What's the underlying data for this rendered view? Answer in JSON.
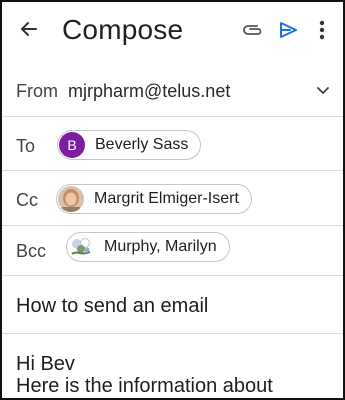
{
  "app_bar": {
    "title": "Compose",
    "back_icon": "arrow-left-icon",
    "attach_icon": "paperclip-icon",
    "send_icon": "send-icon",
    "more_icon": "more-vertical-icon"
  },
  "from": {
    "label": "From",
    "value": "mjrpharm@telus.net",
    "chevron_icon": "chevron-down-icon"
  },
  "to": {
    "label": "To",
    "recipients": [
      {
        "name": "Beverly Sass",
        "avatar_letter": "B",
        "avatar_color": "#7b1fa2"
      }
    ]
  },
  "cc": {
    "label": "Cc",
    "recipients": [
      {
        "name": "Margrit Elmiger-Isert",
        "avatar_icon": "person-photo-avatar"
      }
    ]
  },
  "bcc": {
    "label": "Bcc",
    "recipients": [
      {
        "name": "Murphy, Marilyn",
        "avatar_icon": "flower-photo-avatar"
      }
    ]
  },
  "subject": {
    "value": "How to send an email"
  },
  "body": {
    "lines": [
      "Hi Bev",
      "Here is the information about"
    ]
  },
  "colors": {
    "send_accent": "#1a73e8",
    "avatar_purple": "#7b1fa2",
    "divider": "#dadce0"
  }
}
